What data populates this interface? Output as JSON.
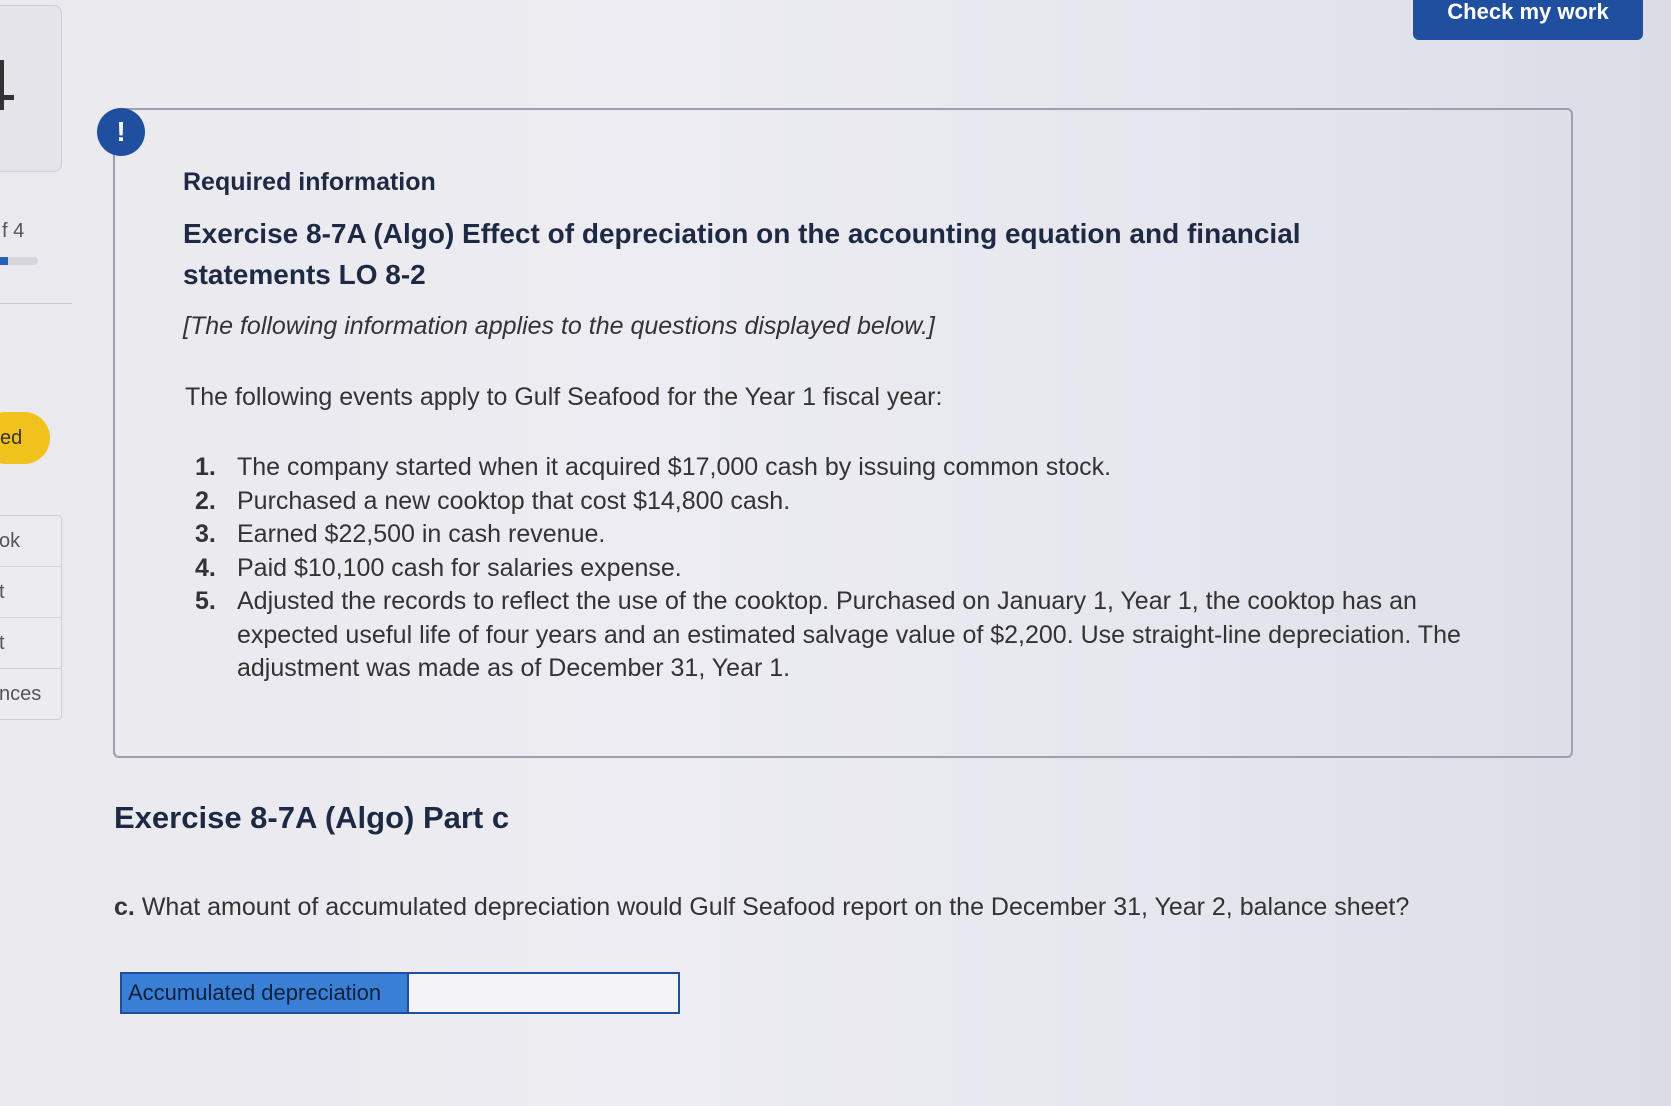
{
  "sidebar": {
    "page_indicator": "f 4",
    "badge": "ed",
    "items": [
      "ok",
      "t",
      "t",
      "nces"
    ]
  },
  "toolbar": {
    "check_label": "Check my work"
  },
  "info": {
    "alert_symbol": "!",
    "required": "Required information",
    "title": "Exercise 8-7A (Algo) Effect of depreciation on the accounting equation and financial statements LO 8-2",
    "note": "[The following information applies to the questions displayed below.]",
    "intro": "The following events apply to Gulf Seafood for the Year 1 fiscal year:",
    "events": [
      {
        "num": "1.",
        "text": "The company started when it acquired $17,000 cash by issuing common stock."
      },
      {
        "num": "2.",
        "text": "Purchased a new cooktop that cost $14,800 cash."
      },
      {
        "num": "3.",
        "text": "Earned $22,500 in cash revenue."
      },
      {
        "num": "4.",
        "text": "Paid $10,100 cash for salaries expense."
      },
      {
        "num": "5.",
        "text": "Adjusted the records to reflect the use of the cooktop. Purchased on January 1, Year 1, the cooktop has an expected useful life of four years and an estimated salvage value of $2,200. Use straight-line depreciation. The adjustment was made as of December 31, Year 1."
      }
    ]
  },
  "part": {
    "title": "Exercise 8-7A (Algo) Part c",
    "question_letter": "c.",
    "question": "What amount of accumulated depreciation would Gulf Seafood report on the December 31, Year 2, balance sheet?"
  },
  "answer": {
    "label": "Accumulated depreciation",
    "value": ""
  }
}
